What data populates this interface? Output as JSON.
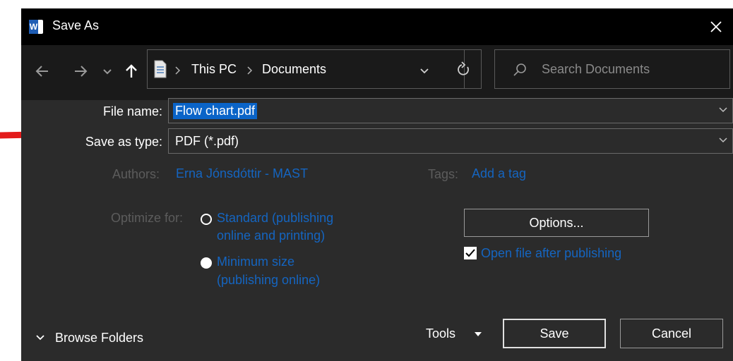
{
  "titlebar": {
    "title": "Save As",
    "app_icon_letter": "W"
  },
  "navbar": {
    "breadcrumb": [
      "This PC",
      "Documents"
    ],
    "search_placeholder": "Search Documents"
  },
  "form": {
    "file_name_label": "File name:",
    "file_name_value": "Flow chart.pdf",
    "save_type_label": "Save as type:",
    "save_type_value": "PDF (*.pdf)",
    "authors_label": "Authors:",
    "authors_value": "Erna Jónsdóttir - MAST",
    "tags_label": "Tags:",
    "tags_value": "Add a tag",
    "optimize_label": "Optimize for:",
    "option_standard_line1": "Standard (publishing",
    "option_standard_line2": "online and printing)",
    "option_minimum_line1": "Minimum size",
    "option_minimum_line2": "(publishing online)",
    "options_button": "Options...",
    "open_after_label": "Open file after publishing",
    "open_after_checked": true
  },
  "footer": {
    "browse_folders": "Browse Folders",
    "tools": "Tools",
    "save": "Save",
    "cancel": "Cancel"
  },
  "colors": {
    "dialog_bg": "#2b2b2b",
    "titlebar_bg": "#000000",
    "link": "#1565c0",
    "selection": "#0a64c8",
    "annotation_arrow": "#e31b1b"
  }
}
